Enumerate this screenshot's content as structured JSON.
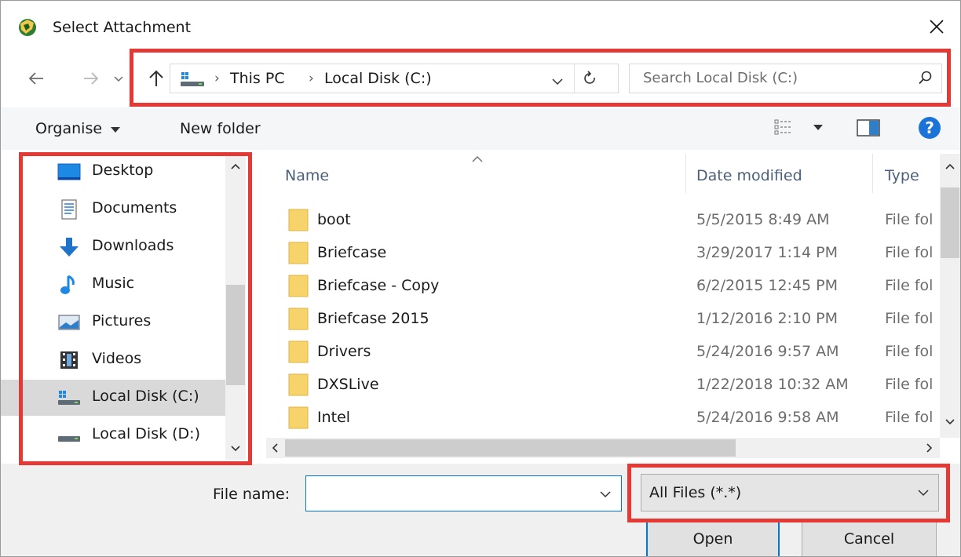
{
  "window": {
    "title": "Select Attachment"
  },
  "address_bar": {
    "crumbs": [
      "This PC",
      "Local Disk (C:)"
    ]
  },
  "search": {
    "placeholder": "Search Local Disk (C:)"
  },
  "toolbar": {
    "organise_label": "Organise",
    "new_folder_label": "New folder"
  },
  "nav_pane": {
    "items": [
      {
        "label": "Desktop",
        "icon": "desktop-icon"
      },
      {
        "label": "Documents",
        "icon": "documents-icon"
      },
      {
        "label": "Downloads",
        "icon": "downloads-icon"
      },
      {
        "label": "Music",
        "icon": "music-icon"
      },
      {
        "label": "Pictures",
        "icon": "pictures-icon"
      },
      {
        "label": "Videos",
        "icon": "videos-icon"
      },
      {
        "label": "Local Disk (C:)",
        "icon": "drive-c-icon",
        "selected": true
      },
      {
        "label": "Local Disk (D:)",
        "icon": "drive-icon"
      }
    ]
  },
  "file_list": {
    "columns": [
      "Name",
      "Date modified",
      "Type"
    ],
    "rows": [
      {
        "name": "boot",
        "date": "5/5/2015 8:49 AM",
        "type": "File fol"
      },
      {
        "name": "Briefcase",
        "date": "3/29/2017 1:14 PM",
        "type": "File fol"
      },
      {
        "name": "Briefcase - Copy",
        "date": "6/2/2015 12:45 PM",
        "type": "File fol"
      },
      {
        "name": "Briefcase 2015",
        "date": "1/12/2016 2:10 PM",
        "type": "File fol"
      },
      {
        "name": "Drivers",
        "date": "5/24/2016 9:57 AM",
        "type": "File fol"
      },
      {
        "name": "DXSLive",
        "date": "1/22/2018 10:32 AM",
        "type": "File fol"
      },
      {
        "name": "Intel",
        "date": "5/24/2016 9:58 AM",
        "type": "File fol"
      }
    ]
  },
  "bottom": {
    "file_name_label": "File name:",
    "file_name_value": "",
    "filter_value": "All Files (*.*)",
    "open_label": "Open",
    "cancel_label": "Cancel"
  },
  "colors": {
    "highlight": "#e53935",
    "folder": "#f7d46b",
    "accent": "#0078d7",
    "help": "#1a73d9"
  }
}
